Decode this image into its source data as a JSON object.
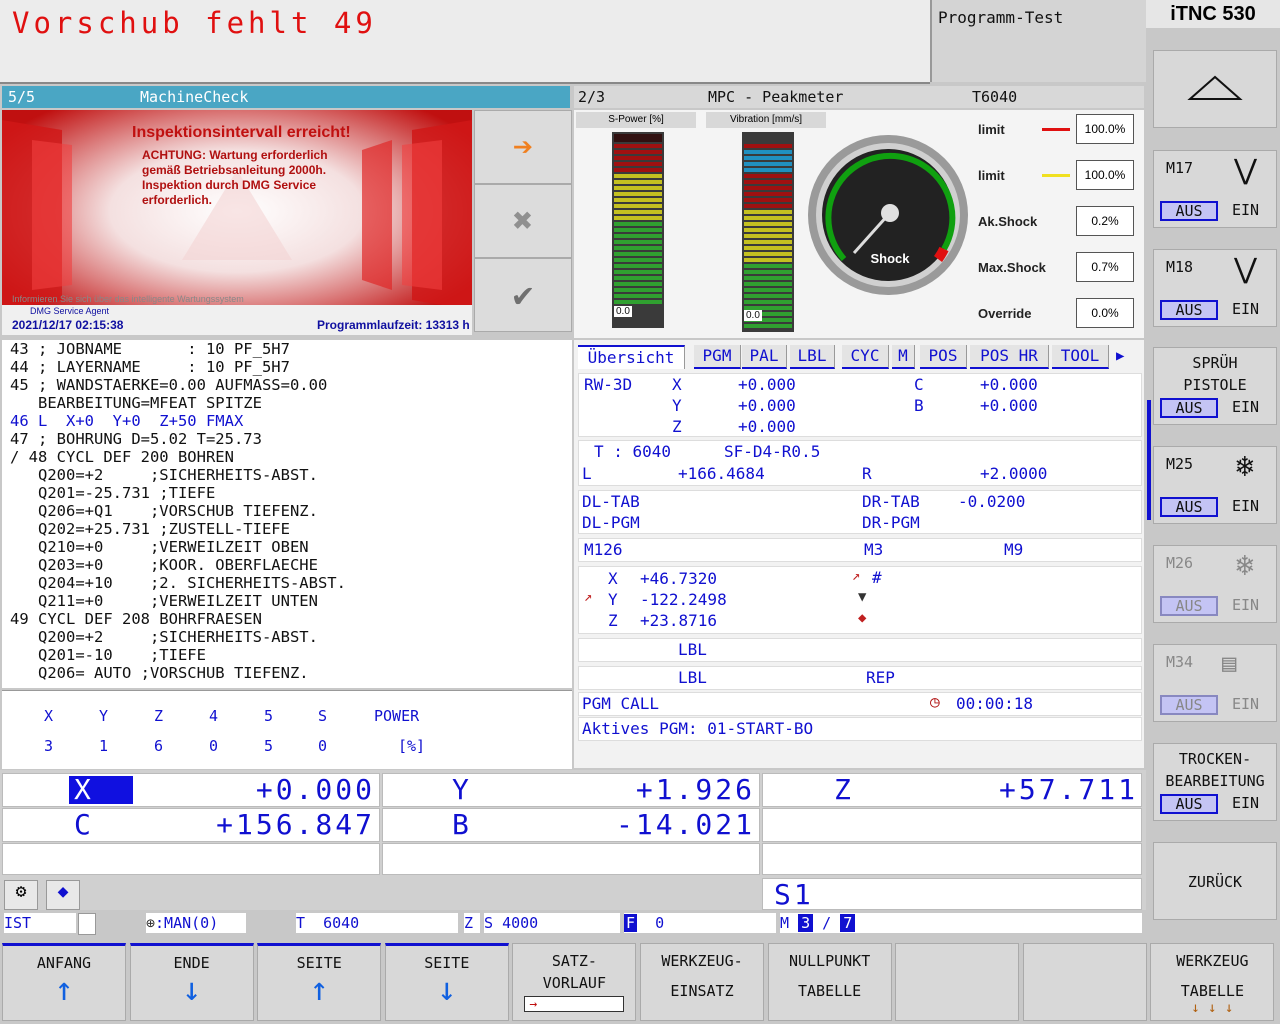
{
  "top": {
    "message": "Vorschub fehlt 49",
    "mode": "Programm-Test",
    "control": "iTNC 530"
  },
  "machinecheck": {
    "index": "5/5",
    "title": "MachineCheck",
    "headline": "Inspektionsintervall erreicht!",
    "body": [
      "ACHTUNG: Wartung erforderlich",
      "gemäß Betriebsanleitung 2000h.",
      "Inspektion durch DMG Service",
      "erforderlich."
    ],
    "info": "Informieren Sie sich über das intelligente Wartungssystem",
    "agent": "DMG Service Agent",
    "datetime": "2021/12/17 02:15:38",
    "runtime": "Programmlaufzeit: 13313 h"
  },
  "peakmeter": {
    "index": "2/3",
    "title": "MPC - Peakmeter",
    "tool": "T6040",
    "spower_label": "S-Power [%]",
    "vib_label": "Vibration [mm/s]",
    "spower_val": "0.0",
    "vib_val": "0.0",
    "gauge_label": "Shock",
    "rows": [
      {
        "label": "limit",
        "value": "100.0%",
        "color": "#e01010"
      },
      {
        "label": "limit",
        "value": "100.0%",
        "color": "#f0e020"
      },
      {
        "label": "Ak.Shock",
        "value": "0.2%"
      },
      {
        "label": "Max.Shock",
        "value": "0.7%"
      },
      {
        "label": "Override",
        "value": "0.0%"
      }
    ]
  },
  "program": {
    "lines": [
      "43 ; JOBNAME       : 10 PF_5H7",
      "44 ; LAYERNAME     : 10 PF_5H7",
      "45 ; WANDSTAERKE=0.00 AUFMASS=0.00",
      "   BEARBEITUNG=MFEAT SPITZE",
      "46 L  X+0  Y+0  Z+50 FMAX",
      "47 ; BOHRUNG D=5.02 T=25.73",
      "/ 48 CYCL DEF 200 BOHREN",
      "   Q200=+2     ;SICHERHEITS-ABST.",
      "   Q201=-25.731 ;TIEFE",
      "   Q206=+Q1    ;VORSCHUB TIEFENZ.",
      "   Q202=+25.731 ;ZUSTELL-TIEFE",
      "   Q210=+0     ;VERWEILZEIT OBEN",
      "   Q203=+0     ;KOOR. OBERFLAECHE",
      "   Q204=+10    ;2. SICHERHEITS-ABST.",
      "   Q211=+0     ;VERWEILZEIT UNTEN",
      "49 CYCL DEF 208 BOHRFRAESEN",
      "   Q200=+2     ;SICHERHEITS-ABST.",
      "   Q201=-10    ;TIEFE",
      "   Q206= AUTO ;VORSCHUB TIEFENZ."
    ],
    "active_line": 4
  },
  "axis_table": {
    "headers": [
      "X",
      "Y",
      "Z",
      "4",
      "5",
      "S",
      "POWER"
    ],
    "values": [
      "3",
      "1",
      "6",
      "0",
      "5",
      "0",
      "[%]"
    ]
  },
  "status": {
    "tabs": [
      "Übersicht",
      "PGM",
      "PAL",
      "LBL",
      "CYC",
      "M",
      "POS",
      "POS HR",
      "TOOL"
    ],
    "rw3d": "RW-3D",
    "rw": [
      [
        "X",
        "+0.000"
      ],
      [
        "Y",
        "+0.000"
      ],
      [
        "Z",
        "+0.000"
      ]
    ],
    "rot": [
      [
        "C",
        "+0.000"
      ],
      [
        "B",
        "+0.000"
      ]
    ],
    "tool_t": "T : 6040",
    "tool_name": "SF-D4-R0.5",
    "l_label": "L",
    "l_val": "+166.4684",
    "r_label": "R",
    "r_val": "+2.0000",
    "dltab": "DL-TAB",
    "drtab": "DR-TAB",
    "drtab_val": "-0.0200",
    "dlpgm": "DL-PGM",
    "drpgm": "DR-PGM",
    "m1": "M126",
    "m2": "M3",
    "m3": "M9",
    "pos": [
      [
        "X",
        "+46.7320"
      ],
      [
        "Y",
        "-122.2498"
      ],
      [
        "Z",
        "+23.8716"
      ]
    ],
    "pos_hash": "#",
    "lbl1": "LBL",
    "lbl2": "LBL",
    "rep": "REP",
    "pgmcall": "PGM CALL",
    "time": "00:00:18",
    "active_pgm": "Aktives PGM: 01-START-BO"
  },
  "positions": {
    "x_label": "X",
    "x_val": "+0.000",
    "y_label": "Y",
    "y_val": "+1.926",
    "z_label": "Z",
    "z_val": "+57.711",
    "c_label": "C",
    "c_val": "+156.847",
    "b_label": "B",
    "b_val": "-14.021",
    "s_label": "S1"
  },
  "statusbar": {
    "ist": "IST",
    "man": ":MAN(0)",
    "t": "T",
    "t_val": "6040",
    "z": "Z",
    "s": "S",
    "s_val": "4000",
    "f": "F",
    "f_val": "0",
    "m": "M",
    "m_a": "3",
    "m_sep": "/",
    "m_b": "7"
  },
  "right_keys": [
    {
      "name": "M17"
    },
    {
      "name": "M18"
    },
    {
      "line1": "SPRÜH",
      "line2": "PISTOLE"
    },
    {
      "name": "M25"
    },
    {
      "name": "M26"
    },
    {
      "name": "M34"
    },
    {
      "line1": "TROCKEN-",
      "line2": "BEARBEITUNG"
    },
    {
      "label": "ZURÜCK"
    }
  ],
  "aus": "AUS",
  "ein": "EIN",
  "bottom_keys": [
    {
      "line1": "ANFANG"
    },
    {
      "line1": "ENDE"
    },
    {
      "line1": "SEITE"
    },
    {
      "line1": "SEITE"
    },
    {
      "line1": "SATZ-",
      "line2": "VORLAUF"
    },
    {
      "line1": "WERKZEUG-",
      "line2": "EINSATZ"
    },
    {
      "line1": "NULLPUNKT",
      "line2": "TABELLE"
    },
    {
      "line1": ""
    },
    {
      "line1": ""
    },
    {
      "line1": "WERKZEUG",
      "line2": "TABELLE"
    }
  ]
}
